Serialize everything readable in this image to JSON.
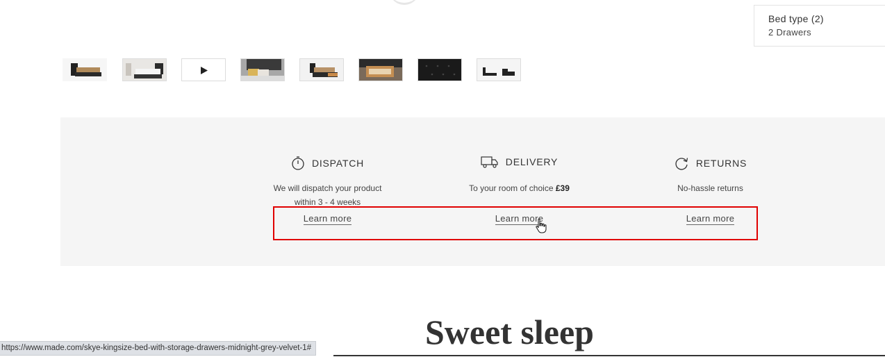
{
  "bed_type": {
    "label": "Bed type (2)",
    "value": "2 Drawers"
  },
  "thumbnails": [
    {
      "name": "thumbnail-bed-front",
      "kind": "photo",
      "bg": "#f2f2f2"
    },
    {
      "name": "thumbnail-bed-room",
      "kind": "photo",
      "bg": "#e8e6e3"
    },
    {
      "name": "thumbnail-video",
      "kind": "video",
      "bg": "#ffffff"
    },
    {
      "name": "thumbnail-headboard-detail",
      "kind": "photo",
      "bg": "#9a9a9a"
    },
    {
      "name": "thumbnail-bed-drawer-open",
      "kind": "photo",
      "bg": "#efefef"
    },
    {
      "name": "thumbnail-drawer-closeup",
      "kind": "photo",
      "bg": "#8a7a6a"
    },
    {
      "name": "thumbnail-velvet-fabric",
      "kind": "photo",
      "bg": "#1b1b1b"
    },
    {
      "name": "thumbnail-dimensions",
      "kind": "photo",
      "bg": "#f4f4f4"
    }
  ],
  "info": {
    "dispatch": {
      "title": "DISPATCH",
      "desc_line1": "We will dispatch your product",
      "desc_line2": "within 3 - 4 weeks",
      "link": "Learn more",
      "icon": "stopwatch-icon"
    },
    "delivery": {
      "title": "DELIVERY",
      "desc_prefix": "To your room of choice ",
      "desc_price": "£39",
      "link": "Learn more",
      "icon": "truck-icon"
    },
    "returns": {
      "title": "RETURNS",
      "desc": "No-hassle returns",
      "link": "Learn more",
      "icon": "refresh-icon"
    }
  },
  "heading": "Sweet sleep",
  "status_url": "https://www.made.com/skye-kingsize-bed-with-storage-drawers-midnight-grey-velvet-1#",
  "colors": {
    "panel_bg": "#f5f5f5",
    "highlight": "#e00000"
  }
}
